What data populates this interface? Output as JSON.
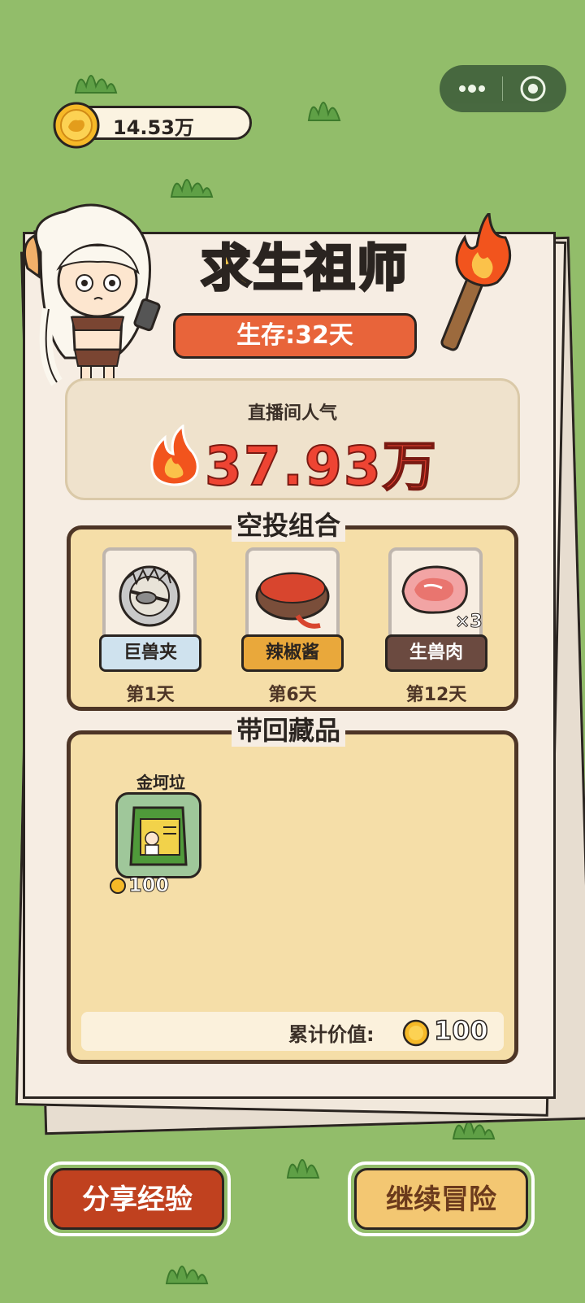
{
  "header": {
    "coins": "14.53万"
  },
  "capsule": {
    "more_icon": "more-dots-icon",
    "close_icon": "target-close-icon"
  },
  "title": "求生祖师",
  "survival": "生存:32天",
  "popularity": {
    "label": "直播间人气",
    "value": "37.93万"
  },
  "airdrop": {
    "title": "空投组合",
    "items": [
      {
        "name": "巨兽夹",
        "day": "第1天",
        "label_bg": "#cfe2ee",
        "label_color": "#2a2420"
      },
      {
        "name": "辣椒酱",
        "day": "第6天",
        "label_bg": "#e9a83b",
        "label_color": "#2a2420"
      },
      {
        "name": "生兽肉",
        "day": "第12天",
        "label_bg": "#6b4a40",
        "label_color": "#ffffff",
        "qty": "×3"
      }
    ]
  },
  "collection": {
    "title": "带回藏品",
    "items": [
      {
        "name": "金坷垃",
        "price": "100"
      }
    ],
    "total_label": "累计价值:",
    "total_value": "100"
  },
  "buttons": {
    "share": "分享经验",
    "continue": "继续冒险"
  },
  "colors": {
    "background": "#92bd6a",
    "accent": "#ee4433",
    "panel": "#f5dea8"
  }
}
